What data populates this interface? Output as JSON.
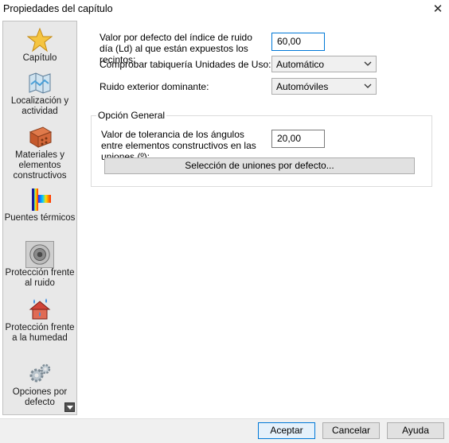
{
  "window": {
    "title": "Propiedades del capítulo",
    "close_glyph": "✕"
  },
  "sidebar": {
    "items": [
      {
        "label": "Capítulo",
        "icon": "star-icon"
      },
      {
        "label": "Localización y actividad",
        "icon": "map-icon"
      },
      {
        "label": "Materiales y elementos constructivos",
        "icon": "brick-icon"
      },
      {
        "label": "Puentes térmicos",
        "icon": "thermal-bridge-icon"
      },
      {
        "label": "Protección frente al ruido",
        "icon": "speaker-icon",
        "active": true
      },
      {
        "label": "Protección frente a la humedad",
        "icon": "humidity-icon"
      },
      {
        "label": "Opciones por defecto",
        "icon": "gears-icon"
      }
    ]
  },
  "main": {
    "ld_label": "Valor por defecto del índice de ruido día (Ld) al que están expuestos los recintos:",
    "ld_value": "60,00",
    "tabiqueria_label": "Comprobar tabiquería Unidades de Uso:",
    "tabiqueria_value": "Automático",
    "ruido_label": "Ruido exterior dominante:",
    "ruido_value": "Automóviles",
    "general_group_title": "Opción General",
    "tolerancia_label": "Valor de tolerancia de los ángulos entre elementos constructivos en las uniones (º):",
    "tolerancia_value": "20,00",
    "uniones_button": "Selección de uniones por defecto..."
  },
  "footer": {
    "accept": "Aceptar",
    "cancel": "Cancelar",
    "help": "Ayuda"
  },
  "colors": {
    "focus": "#0078d7",
    "button_bg": "#e1e1e1",
    "sidebar_bg": "#e8e8e8"
  }
}
